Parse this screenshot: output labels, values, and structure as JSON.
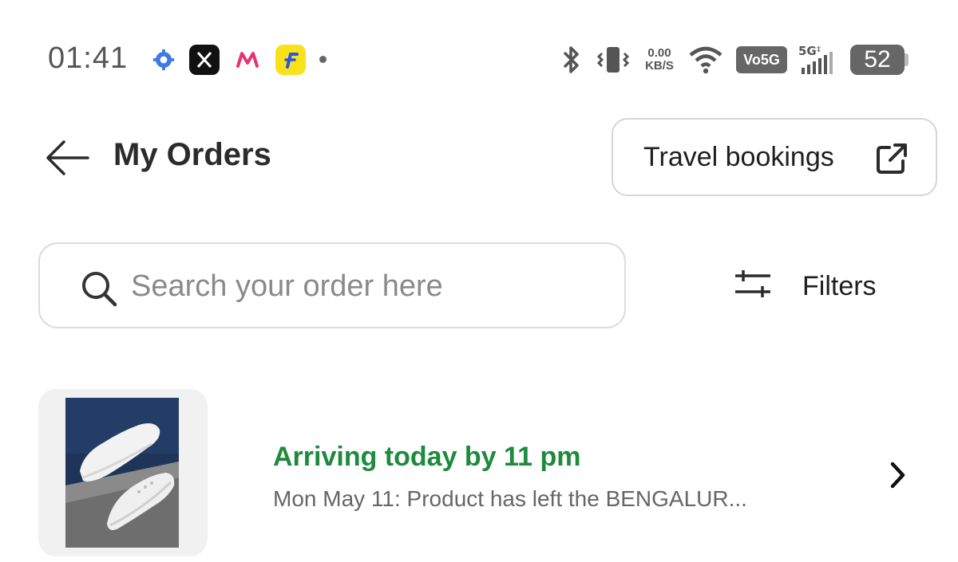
{
  "status_bar": {
    "time": "01:41",
    "notification_icons": [
      "gear-icon",
      "x-app-icon",
      "myntra-icon",
      "flipkart-icon"
    ],
    "network_speed_value": "0.00",
    "network_speed_unit": "KB/S",
    "network_badge": "Vo5G",
    "signal_label": "5G",
    "battery_level": "52"
  },
  "header": {
    "title": "My Orders",
    "travel_button_label": "Travel bookings"
  },
  "search": {
    "placeholder": "Search your order here",
    "value": ""
  },
  "filters": {
    "label": "Filters"
  },
  "orders": [
    {
      "status": "Arriving today by 11 pm",
      "detail": "Mon May 11: Product has left the BENGALUR..."
    }
  ],
  "colors": {
    "status_green": "#1e8a3c",
    "flipkart_yellow": "#f9e11b",
    "myntra_pink": "#e8336f"
  }
}
